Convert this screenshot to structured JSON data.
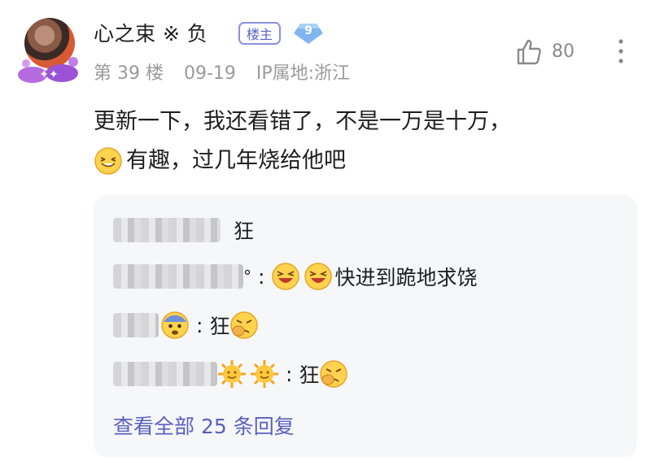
{
  "post": {
    "username": "心之束 ※ 负",
    "owner_tag": "楼主",
    "level": "9",
    "floor": "第 39 楼",
    "date": "09-19",
    "ip_location": "IP属地:浙江",
    "like_count": "80",
    "content_line1": "更新一下，我还看错了，不是一万是十万，",
    "content_line2": "有趣，过几年烧给他吧"
  },
  "replies": [
    {
      "text": "狂"
    },
    {
      "suffix": "°",
      "text": "快进到跪地求饶"
    },
    {
      "text": "狂"
    },
    {
      "text": "狂"
    }
  ],
  "view_all": "查看全部 25 条回复",
  "icons": [
    "thumbs-up-icon",
    "more-vertical-icon",
    "laughing-emoji",
    "grinning-squint-emoji",
    "fearful-emoji",
    "angry-fist-emoji",
    "sun-emoji"
  ],
  "colors": {
    "accent": "#5a5fbf",
    "meta": "#9a9a9a",
    "reply_bg": "#f6f7f9"
  }
}
